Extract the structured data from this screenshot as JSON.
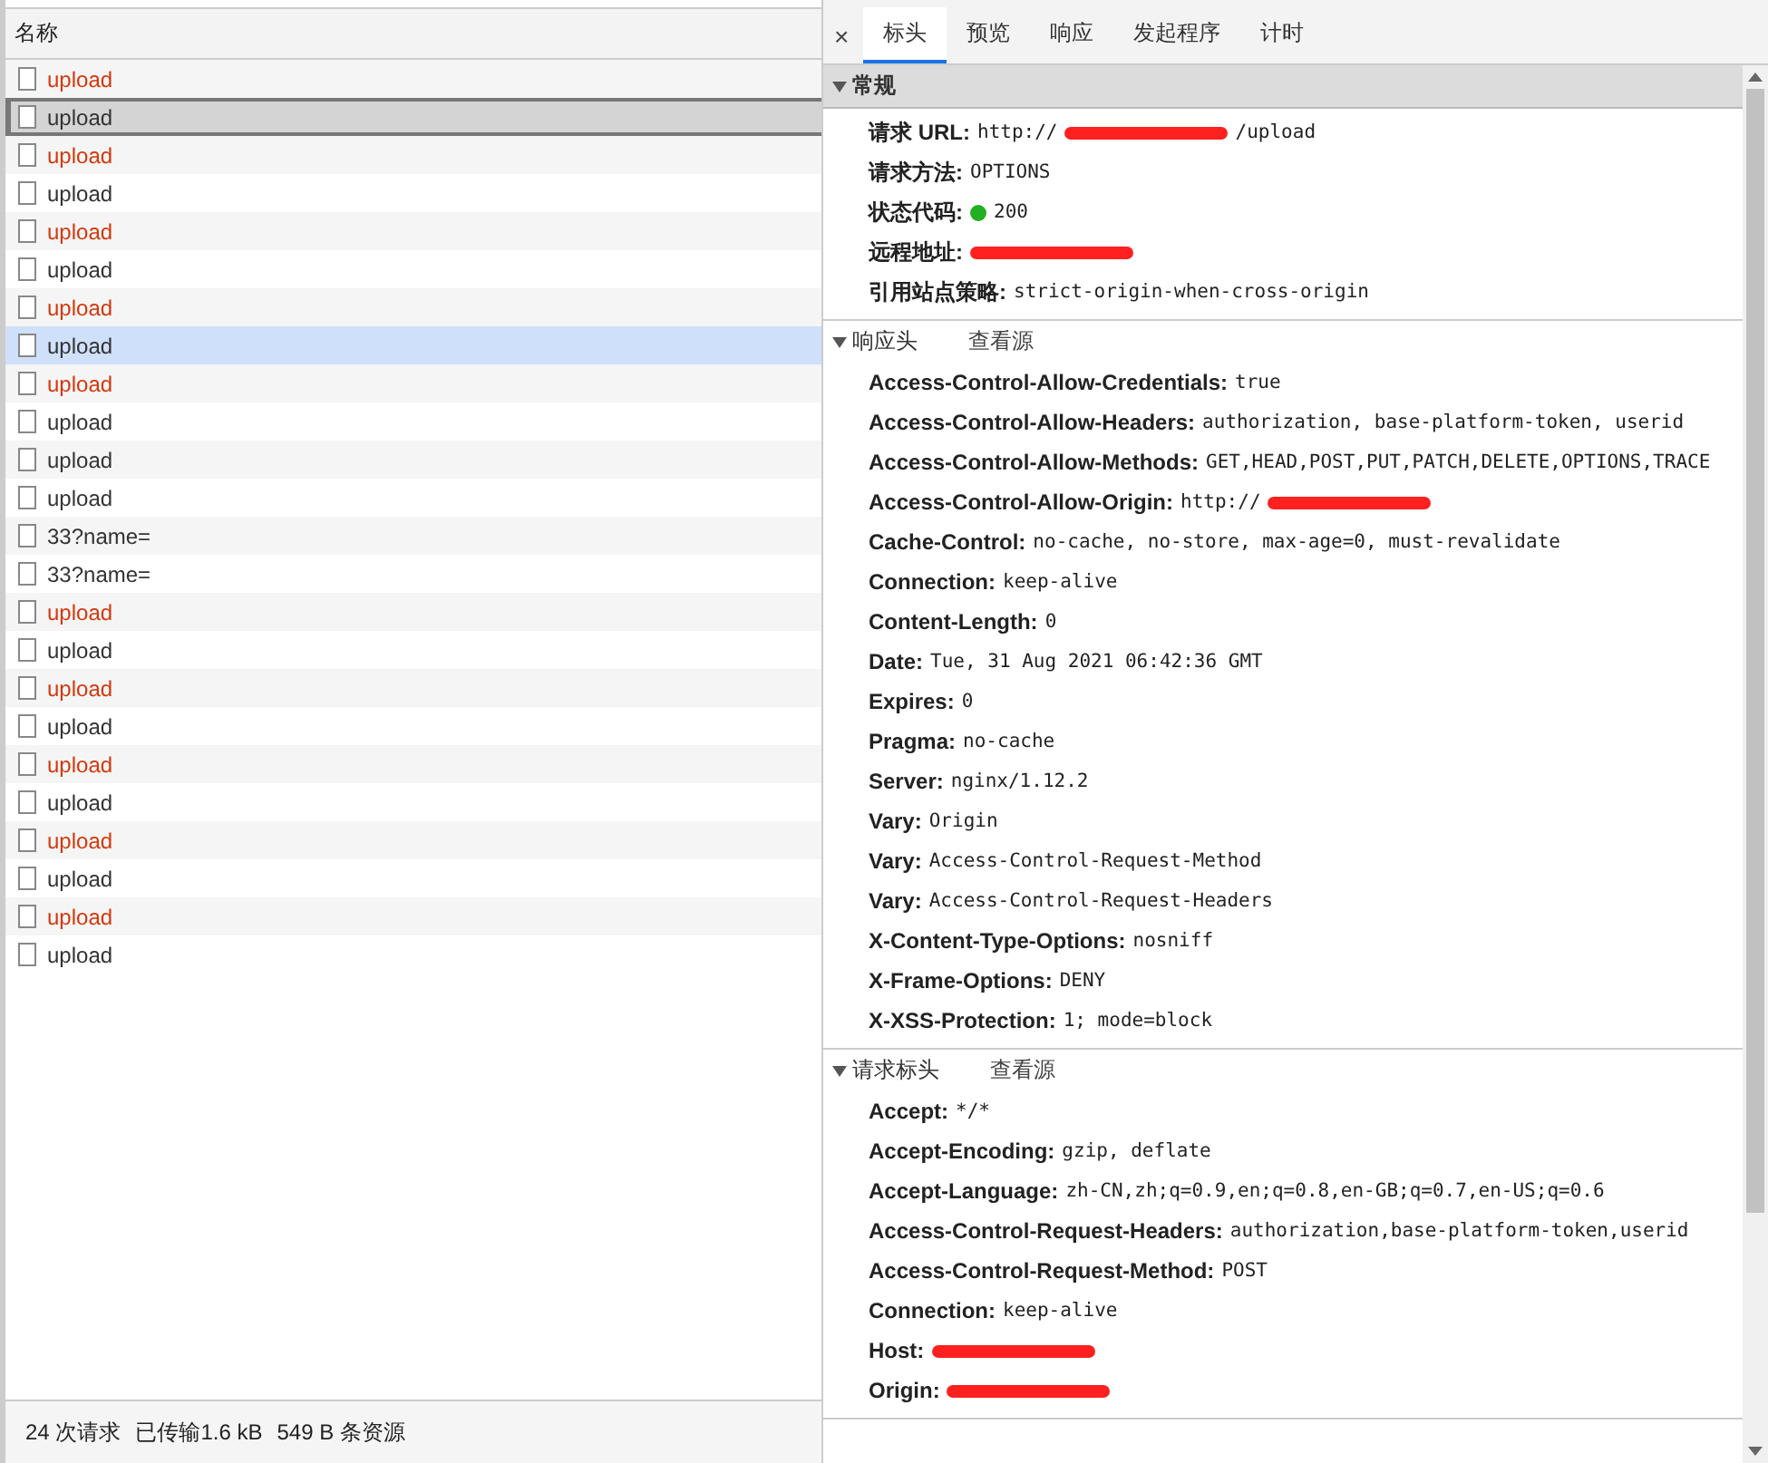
{
  "request_list": {
    "column": "名称",
    "rows": [
      {
        "name": "upload",
        "failed": true,
        "selected": false,
        "hovered": false
      },
      {
        "name": "upload",
        "failed": false,
        "selected": true,
        "hovered": false
      },
      {
        "name": "upload",
        "failed": true,
        "selected": false,
        "hovered": false
      },
      {
        "name": "upload",
        "failed": false,
        "selected": false,
        "hovered": false
      },
      {
        "name": "upload",
        "failed": true,
        "selected": false,
        "hovered": false
      },
      {
        "name": "upload",
        "failed": false,
        "selected": false,
        "hovered": false
      },
      {
        "name": "upload",
        "failed": true,
        "selected": false,
        "hovered": false
      },
      {
        "name": "upload",
        "failed": false,
        "selected": false,
        "hovered": true
      },
      {
        "name": "upload",
        "failed": true,
        "selected": false,
        "hovered": false
      },
      {
        "name": "upload",
        "failed": false,
        "selected": false,
        "hovered": false
      },
      {
        "name": "upload",
        "failed": false,
        "selected": false,
        "hovered": false
      },
      {
        "name": "upload",
        "failed": false,
        "selected": false,
        "hovered": false
      },
      {
        "name": "33?name=",
        "failed": false,
        "selected": false,
        "hovered": false
      },
      {
        "name": "33?name=",
        "failed": false,
        "selected": false,
        "hovered": false
      },
      {
        "name": "upload",
        "failed": true,
        "selected": false,
        "hovered": false
      },
      {
        "name": "upload",
        "failed": false,
        "selected": false,
        "hovered": false
      },
      {
        "name": "upload",
        "failed": true,
        "selected": false,
        "hovered": false
      },
      {
        "name": "upload",
        "failed": false,
        "selected": false,
        "hovered": false
      },
      {
        "name": "upload",
        "failed": true,
        "selected": false,
        "hovered": false
      },
      {
        "name": "upload",
        "failed": false,
        "selected": false,
        "hovered": false
      },
      {
        "name": "upload",
        "failed": true,
        "selected": false,
        "hovered": false
      },
      {
        "name": "upload",
        "failed": false,
        "selected": false,
        "hovered": false
      },
      {
        "name": "upload",
        "failed": true,
        "selected": false,
        "hovered": false
      },
      {
        "name": "upload",
        "failed": false,
        "selected": false,
        "hovered": false
      }
    ],
    "status_bar": [
      "24 次请求",
      "已传输1.6 kB",
      "549 B 条资源"
    ]
  },
  "details": {
    "close": "×",
    "tabs": [
      {
        "label": "标头",
        "selected": true
      },
      {
        "label": "预览",
        "selected": false
      },
      {
        "label": "响应",
        "selected": false
      },
      {
        "label": "发起程序",
        "selected": false
      },
      {
        "label": "计时",
        "selected": false
      }
    ],
    "sections": [
      {
        "title": "常规",
        "expanded": true,
        "shaded": true,
        "headers": [
          {
            "name": "请求 URL:",
            "parts": [
              {
                "kind": "text",
                "text": "http://"
              },
              {
                "kind": "redacted"
              },
              {
                "kind": "text",
                "text": "/upload"
              }
            ]
          },
          {
            "name": "请求方法:",
            "parts": [
              {
                "kind": "text",
                "text": "OPTIONS"
              }
            ]
          },
          {
            "name": "状态代码:",
            "parts": [
              {
                "kind": "dot"
              },
              {
                "kind": "text",
                "text": "200"
              }
            ]
          },
          {
            "name": "远程地址:",
            "parts": [
              {
                "kind": "redacted"
              }
            ]
          },
          {
            "name": "引用站点策略:",
            "parts": [
              {
                "kind": "text",
                "text": "strict-origin-when-cross-origin"
              }
            ]
          }
        ]
      },
      {
        "title": "响应头",
        "expanded": true,
        "shaded": false,
        "link": "查看源",
        "headers": [
          {
            "name": "Access-Control-Allow-Credentials:",
            "parts": [
              {
                "kind": "text",
                "text": "true"
              }
            ]
          },
          {
            "name": "Access-Control-Allow-Headers:",
            "parts": [
              {
                "kind": "text",
                "text": "authorization, base-platform-token, userid"
              }
            ]
          },
          {
            "name": "Access-Control-Allow-Methods:",
            "parts": [
              {
                "kind": "text",
                "text": "GET,HEAD,POST,PUT,PATCH,DELETE,OPTIONS,TRACE"
              }
            ]
          },
          {
            "name": "Access-Control-Allow-Origin:",
            "parts": [
              {
                "kind": "text",
                "text": "http://"
              },
              {
                "kind": "redacted"
              }
            ]
          },
          {
            "name": "Cache-Control:",
            "parts": [
              {
                "kind": "text",
                "text": "no-cache, no-store, max-age=0, must-revalidate"
              }
            ]
          },
          {
            "name": "Connection:",
            "parts": [
              {
                "kind": "text",
                "text": "keep-alive"
              }
            ]
          },
          {
            "name": "Content-Length:",
            "parts": [
              {
                "kind": "text",
                "text": "0"
              }
            ]
          },
          {
            "name": "Date:",
            "parts": [
              {
                "kind": "text",
                "text": "Tue, 31 Aug 2021 06:42:36 GMT"
              }
            ]
          },
          {
            "name": "Expires:",
            "parts": [
              {
                "kind": "text",
                "text": "0"
              }
            ]
          },
          {
            "name": "Pragma:",
            "parts": [
              {
                "kind": "text",
                "text": "no-cache"
              }
            ]
          },
          {
            "name": "Server:",
            "parts": [
              {
                "kind": "text",
                "text": "nginx/1.12.2"
              }
            ]
          },
          {
            "name": "Vary:",
            "parts": [
              {
                "kind": "text",
                "text": "Origin"
              }
            ]
          },
          {
            "name": "Vary:",
            "parts": [
              {
                "kind": "text",
                "text": "Access-Control-Request-Method"
              }
            ]
          },
          {
            "name": "Vary:",
            "parts": [
              {
                "kind": "text",
                "text": "Access-Control-Request-Headers"
              }
            ]
          },
          {
            "name": "X-Content-Type-Options:",
            "parts": [
              {
                "kind": "text",
                "text": "nosniff"
              }
            ]
          },
          {
            "name": "X-Frame-Options:",
            "parts": [
              {
                "kind": "text",
                "text": "DENY"
              }
            ]
          },
          {
            "name": "X-XSS-Protection:",
            "parts": [
              {
                "kind": "text",
                "text": "1; mode=block"
              }
            ]
          }
        ]
      },
      {
        "title": "请求标头",
        "expanded": true,
        "shaded": false,
        "link": "查看源",
        "headers": [
          {
            "name": "Accept:",
            "parts": [
              {
                "kind": "text",
                "text": "*/*"
              }
            ]
          },
          {
            "name": "Accept-Encoding:",
            "parts": [
              {
                "kind": "text",
                "text": "gzip, deflate"
              }
            ]
          },
          {
            "name": "Accept-Language:",
            "parts": [
              {
                "kind": "text",
                "text": "zh-CN,zh;q=0.9,en;q=0.8,en-GB;q=0.7,en-US;q=0.6"
              }
            ]
          },
          {
            "name": "Access-Control-Request-Headers:",
            "parts": [
              {
                "kind": "text",
                "text": "authorization,base-platform-token,userid"
              }
            ]
          },
          {
            "name": "Access-Control-Request-Method:",
            "parts": [
              {
                "kind": "text",
                "text": "POST"
              }
            ]
          },
          {
            "name": "Connection:",
            "parts": [
              {
                "kind": "text",
                "text": "keep-alive"
              }
            ]
          },
          {
            "name": "Host:",
            "parts": [
              {
                "kind": "redacted"
              }
            ]
          },
          {
            "name": "Origin:",
            "parts": [
              {
                "kind": "redacted"
              }
            ]
          }
        ]
      }
    ]
  }
}
